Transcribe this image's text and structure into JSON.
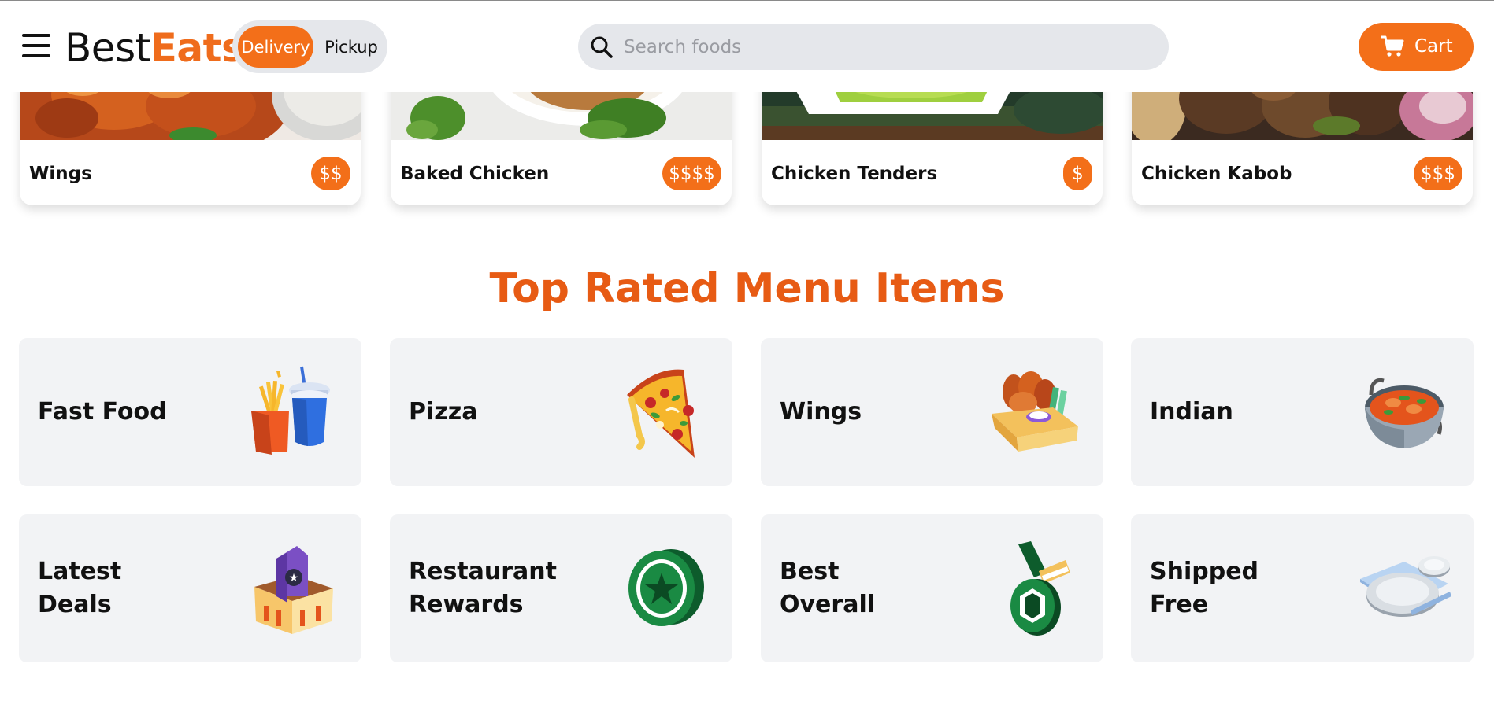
{
  "header": {
    "logo_left": "Best",
    "logo_right": "Eats",
    "mode_delivery": "Delivery",
    "mode_pickup": "Pickup",
    "search_placeholder": "Search foods",
    "cart_label": "Cart",
    "icons": [
      "menu-icon",
      "search-icon",
      "cart-icon"
    ]
  },
  "top_items": [
    {
      "name": "Wings",
      "price": "$$"
    },
    {
      "name": "Baked Chicken",
      "price": "$$$$"
    },
    {
      "name": "Chicken Tenders",
      "price": "$"
    },
    {
      "name": "Chicken Kabob",
      "price": "$$$"
    }
  ],
  "section_title": "Top Rated Menu Items",
  "categories": [
    {
      "label": "Fast Food",
      "icon": "fries-and-drink-icon"
    },
    {
      "label": "Pizza",
      "icon": "pizza-slice-icon"
    },
    {
      "label": "Wings",
      "icon": "wings-basket-icon"
    },
    {
      "label": "Indian",
      "icon": "curry-bowl-icon"
    },
    {
      "label": "Latest Deals",
      "icon": "deal-tag-icon"
    },
    {
      "label": "Restaurant Rewards",
      "icon": "reward-coin-icon"
    },
    {
      "label": "Best Overall",
      "icon": "medal-icon"
    },
    {
      "label": "Shipped Free",
      "icon": "plates-icon"
    }
  ],
  "colors": {
    "brand_orange": "#f36f19",
    "title_orange": "#e75b14",
    "tile_bg": "#f2f3f5",
    "pill_bg": "#e5e7eb"
  }
}
